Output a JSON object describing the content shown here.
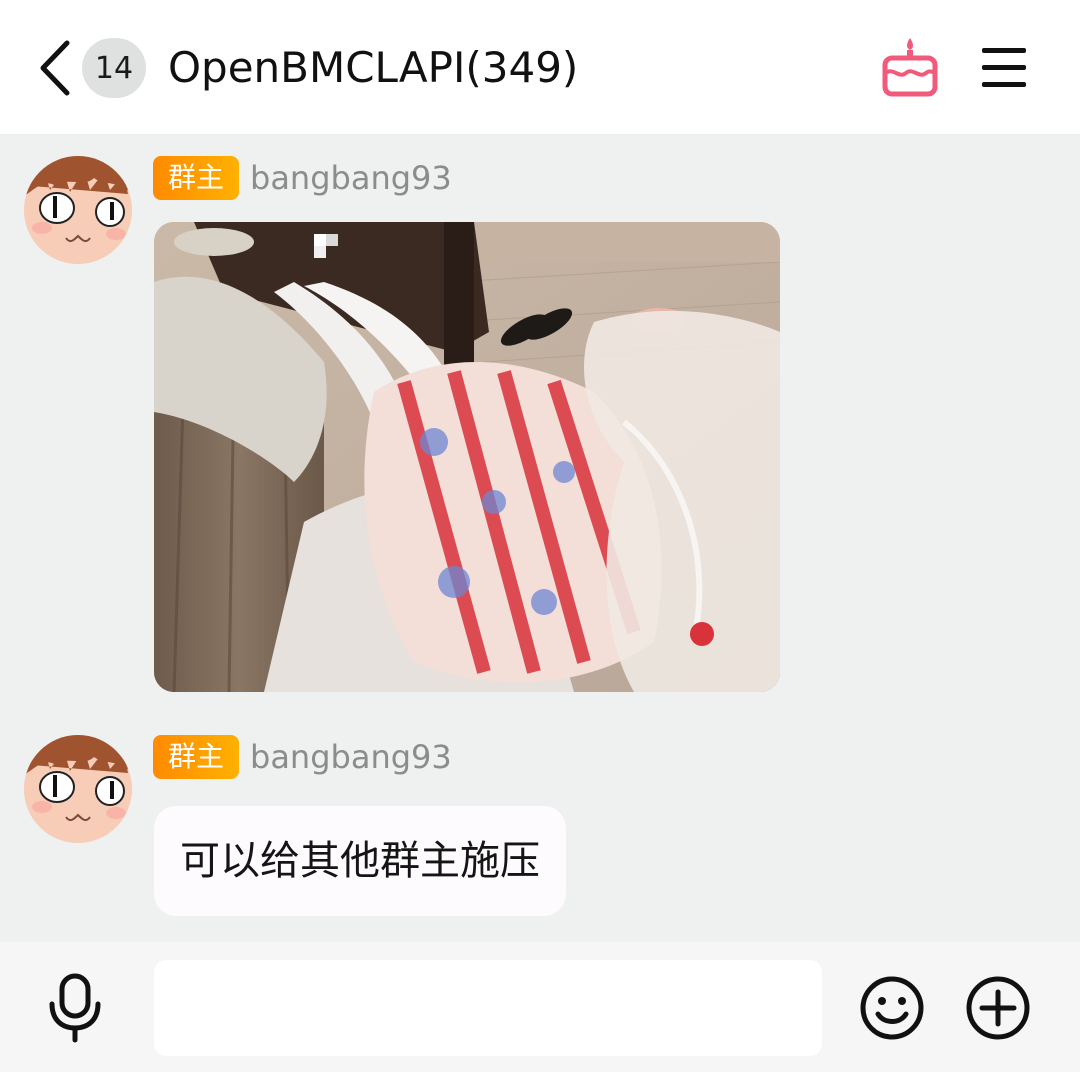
{
  "header": {
    "unread_count": "14",
    "title": "OpenBMCLAPI(349)",
    "back_icon": "chevron-left-icon",
    "cake_icon": "cake-icon",
    "menu_icon": "hamburger-menu-icon",
    "cake_color": "#f25a7c"
  },
  "messages": [
    {
      "role_badge": "群主",
      "sender": "bangbang93",
      "type": "image"
    },
    {
      "role_badge": "群主",
      "sender": "bangbang93",
      "type": "text",
      "text": "可以给其他群主施压"
    }
  ],
  "input_bar": {
    "placeholder": "",
    "value": "",
    "mic_icon": "microphone-icon",
    "emoji_icon": "smiley-icon",
    "plus_icon": "plus-circle-icon"
  },
  "colors": {
    "chat_background": "#eef1ef",
    "badge_gradient_start": "#ff8a00",
    "badge_gradient_end": "#ffb100"
  }
}
